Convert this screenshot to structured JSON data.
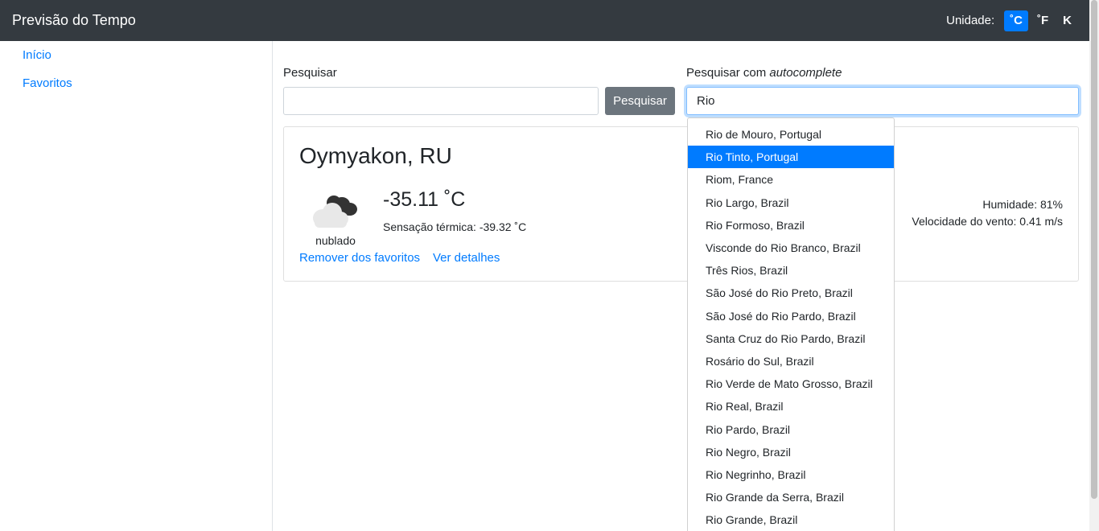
{
  "navbar": {
    "brand": "Previsão do Tempo",
    "unit_label": "Unidade:",
    "units": [
      "˚C",
      "˚F",
      "K"
    ],
    "active_unit": "˚C"
  },
  "sidebar": {
    "items": [
      {
        "label": "Início"
      },
      {
        "label": "Favoritos"
      }
    ]
  },
  "search": {
    "label": "Pesquisar",
    "value": "",
    "button_label": "Pesquisar"
  },
  "autocomplete": {
    "label_prefix": "Pesquisar com ",
    "label_emph": "autocomplete",
    "value": "Rio",
    "highlighted_index": 1,
    "suggestions": [
      "Rio de Mouro, Portugal",
      "Rio Tinto, Portugal",
      "Riom, France",
      "Rio Largo, Brazil",
      "Rio Formoso, Brazil",
      "Visconde do Rio Branco, Brazil",
      "Três Rios, Brazil",
      "São José do Rio Preto, Brazil",
      "São José do Rio Pardo, Brazil",
      "Santa Cruz do Rio Pardo, Brazil",
      "Rosário do Sul, Brazil",
      "Rio Verde de Mato Grosso, Brazil",
      "Rio Real, Brazil",
      "Rio Pardo, Brazil",
      "Rio Negro, Brazil",
      "Rio Negrinho, Brazil",
      "Rio Grande da Serra, Brazil",
      "Rio Grande, Brazil"
    ]
  },
  "weather": {
    "city": "Oymyakon, RU",
    "icon": "cloud-icon",
    "condition": "nublado",
    "temperature": "-35.11 ˚C",
    "feels_like": "Sensação térmica: -39.32 ˚C",
    "humidity": "Humidade: 81%",
    "wind": "Velocidade do vento: 0.41 m/s",
    "remove_favorite": "Remover dos favoritos",
    "details": "Ver detalhes"
  },
  "colors": {
    "navbar": "#343a40",
    "primary": "#007bff",
    "secondary": "#6c757d"
  }
}
